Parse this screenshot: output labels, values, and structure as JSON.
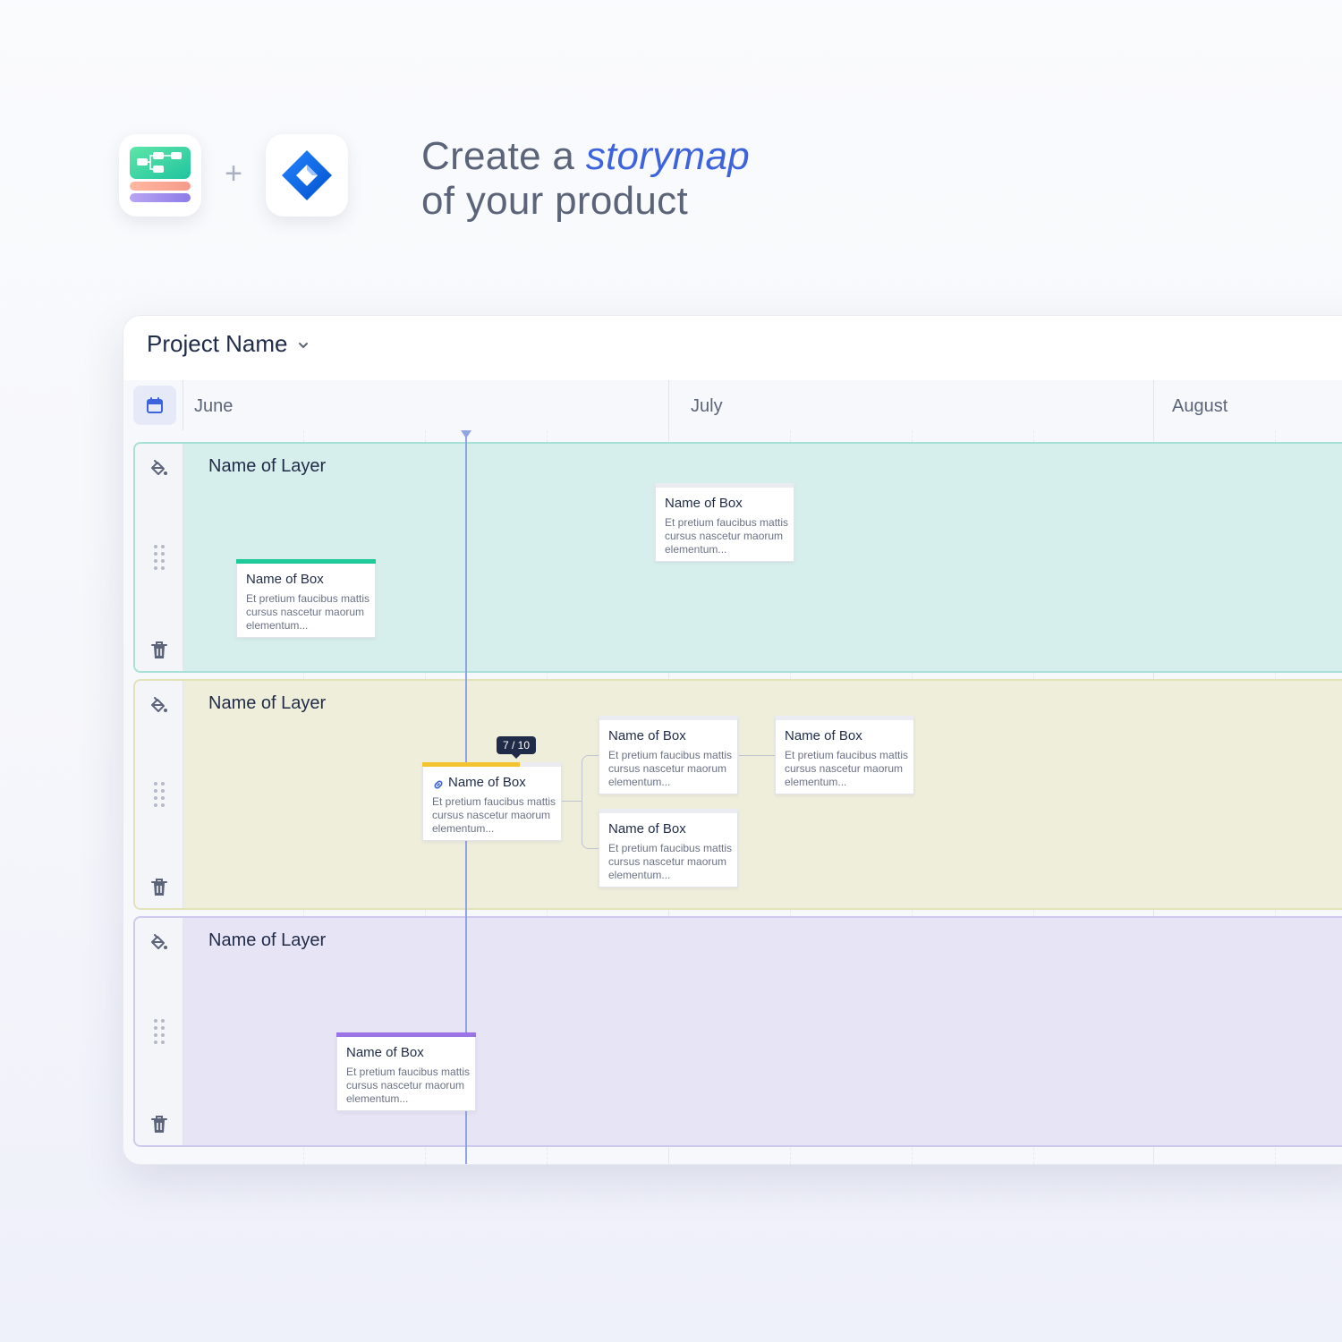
{
  "hero": {
    "headline_prefix": "Create a ",
    "headline_accent": "storymap",
    "headline_line2": "of your product",
    "plus": "+"
  },
  "project": {
    "name": "Project Name"
  },
  "months": [
    "June",
    "July",
    "August"
  ],
  "layers": [
    {
      "title": "Name of Layer",
      "background": "#d7efec",
      "border": "#a6e0d6",
      "boxes": [
        {
          "title": "Name of Box",
          "description": "Et pretium faucibus mattis cursus nascetur maorum elementum...",
          "accent": "#1ec99a",
          "progress": 1
        },
        {
          "title": "Name of Box",
          "description": "Et pretium faucibus mattis cursus nascetur maorum elementum...",
          "accent": null,
          "progress": 0
        }
      ]
    },
    {
      "title": "Name of Layer",
      "background": "#efeedb",
      "border": "#e4e2b8",
      "boxes": [
        {
          "title": "Name of Box",
          "description": "Et pretium faucibus mattis cursus nascetur maorum elementum...",
          "accent": "#f4c430",
          "progress": 0.7,
          "progress_label": "7 / 10",
          "linked": true
        },
        {
          "title": "Name of Box",
          "description": "Et pretium faucibus mattis cursus nascetur maorum elementum...",
          "accent": null,
          "progress": 0
        },
        {
          "title": "Name of Box",
          "description": "Et pretium faucibus mattis cursus nascetur maorum elementum...",
          "accent": null,
          "progress": 0
        },
        {
          "title": "Name of Box",
          "description": "Et pretium faucibus mattis cursus nascetur maorum elementum...",
          "accent": null,
          "progress": 0
        }
      ]
    },
    {
      "title": "Name of Layer",
      "background": "#e7e4f5",
      "border": "#cfc9ee",
      "boxes": [
        {
          "title": "Name of Box",
          "description": "Et pretium faucibus mattis cursus nascetur maorum elementum...",
          "accent": "#9a74e6",
          "progress": 1
        }
      ]
    }
  ],
  "icons": {
    "calendar": "calendar-icon",
    "dropdown": "chevron-down-icon",
    "fill": "paint-bucket-icon",
    "drag": "drag-handle-icon",
    "delete": "trash-icon",
    "link": "link-icon"
  },
  "colors": {
    "accent_text": "#3d63dd",
    "timeline": "#8fa4e2",
    "jira_blue": "#2684ff"
  }
}
